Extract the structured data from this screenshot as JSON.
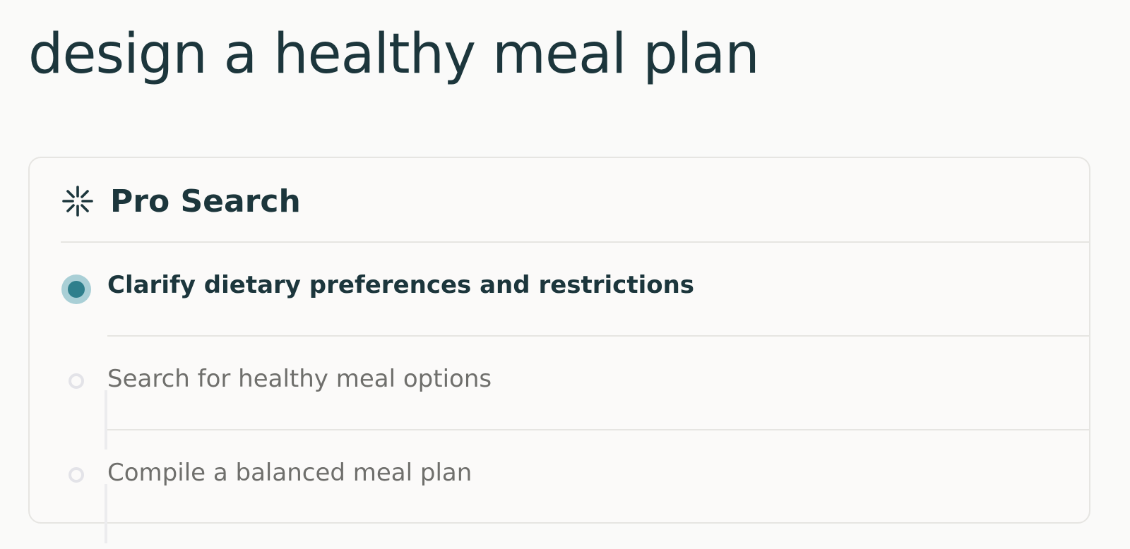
{
  "page": {
    "title": "design a healthy meal plan"
  },
  "card": {
    "icon": "sparkle-icon",
    "title": "Pro Search",
    "steps": [
      {
        "label": "Clarify dietary preferences and restrictions",
        "status": "active"
      },
      {
        "label": "Search for healthy meal options",
        "status": "pending"
      },
      {
        "label": "Compile a balanced meal plan",
        "status": "pending"
      }
    ]
  },
  "colors": {
    "text_primary": "#1c363c",
    "text_muted": "#6f6f6c",
    "accent": "#2f7f8c",
    "accent_halo": "#a9cfd6",
    "border": "#e6e5e2"
  }
}
